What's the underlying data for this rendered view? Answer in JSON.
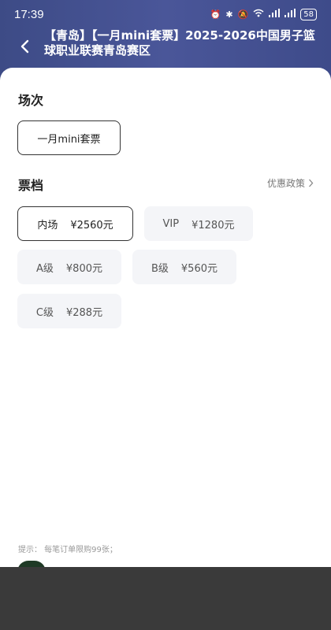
{
  "status_bar": {
    "time": "17:39",
    "battery": "58",
    "icons": [
      "alarm-icon",
      "bluetooth-icon",
      "mute-icon",
      "wifi-icon",
      "signal-icon",
      "signal-icon"
    ]
  },
  "header": {
    "title": "【青岛】【一月mini套票】2025-2026中国男子篮球职业联赛青岛赛区"
  },
  "session": {
    "label": "场次",
    "options": [
      {
        "label": "一月mini套票",
        "selected": true
      }
    ]
  },
  "tiers": {
    "label": "票档",
    "policy_link": "优惠政策",
    "options": [
      {
        "name": "内场",
        "price": "¥2560元",
        "selected": true
      },
      {
        "name": "VIP",
        "price": "¥1280元",
        "selected": false
      },
      {
        "name": "A级",
        "price": "¥800元",
        "selected": false
      },
      {
        "name": "B级",
        "price": "¥560元",
        "selected": false
      },
      {
        "name": "C级",
        "price": "¥288元",
        "selected": false
      }
    ]
  },
  "tip": "提示：  每笔订单限购99张；",
  "colors": {
    "header_bg": "#434f8f",
    "selected_border": "#333333",
    "chip_bg": "#f4f5f8"
  }
}
